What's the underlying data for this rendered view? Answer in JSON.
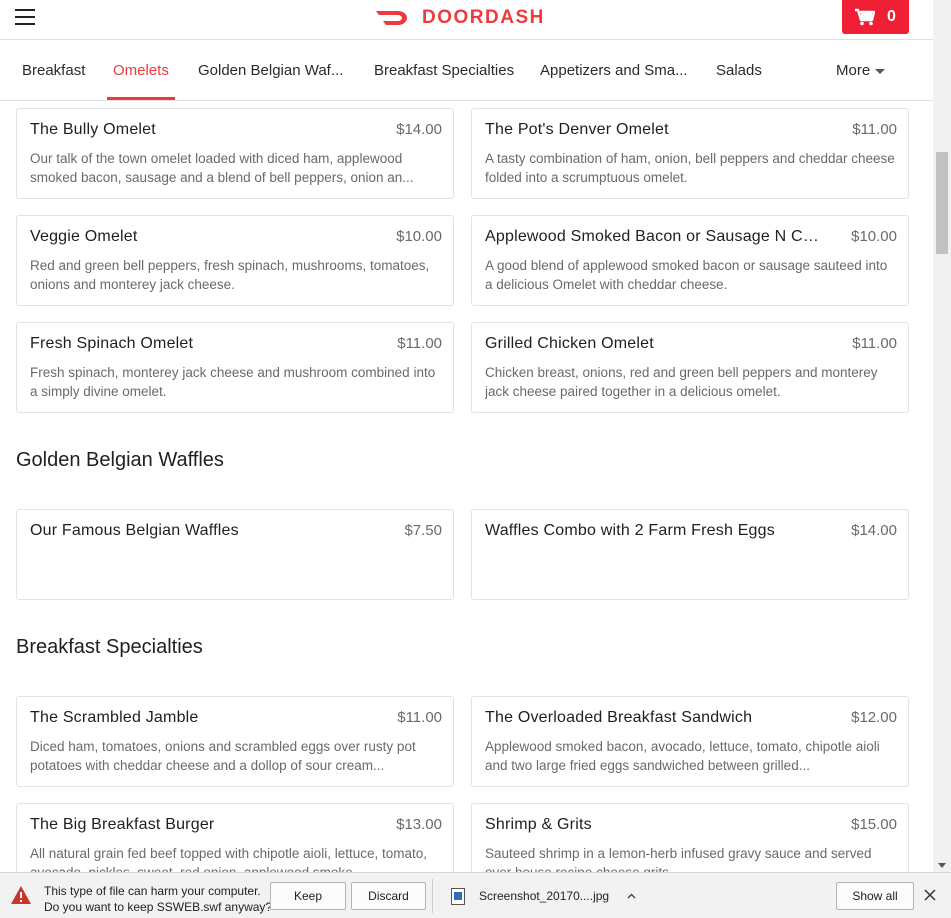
{
  "header": {
    "brand": "DOORDASH",
    "cart_count": "0",
    "brand_color": "#ef3a3d"
  },
  "tabs": [
    {
      "label": "Breakfast",
      "active": false
    },
    {
      "label": "Omelets",
      "active": true
    },
    {
      "label": "Golden Belgian Waf...",
      "active": false
    },
    {
      "label": "Breakfast Specialties",
      "active": false
    },
    {
      "label": "Appetizers and Sma...",
      "active": false
    },
    {
      "label": "Salads",
      "active": false
    },
    {
      "label": "More",
      "active": false
    }
  ],
  "omelets": [
    {
      "name": "The Bully Omelet",
      "price": "$14.00",
      "desc": "Our talk of the town omelet loaded with diced ham, applewood smoked bacon, sausage and a blend of bell peppers, onion an..."
    },
    {
      "name": "The Pot's Denver Omelet",
      "price": "$11.00",
      "desc": "A tasty combination of ham, onion, bell peppers and cheddar cheese folded into a scrumptuous omelet."
    },
    {
      "name": "Veggie Omelet",
      "price": "$10.00",
      "desc": "Red and green bell peppers, fresh spinach, mushrooms, tomatoes, onions and monterey jack cheese."
    },
    {
      "name": "Applewood Smoked Bacon or Sausage N Chee...",
      "price": "$10.00",
      "desc": "A good blend of applewood smoked bacon or sausage sauteed into a delicious Omelet with cheddar cheese."
    },
    {
      "name": "Fresh Spinach Omelet",
      "price": "$11.00",
      "desc": "Fresh spinach, monterey jack cheese and mushroom combined into a simply divine omelet."
    },
    {
      "name": "Grilled Chicken Omelet",
      "price": "$11.00",
      "desc": "Chicken breast, onions, red and green bell peppers and monterey jack cheese paired together in a delicious omelet."
    }
  ],
  "waffles": {
    "title": "Golden Belgian Waffles",
    "items": [
      {
        "name": "Our Famous Belgian Waffles",
        "price": "$7.50",
        "desc": ""
      },
      {
        "name": "Waffles Combo with 2 Farm Fresh Eggs",
        "price": "$14.00",
        "desc": ""
      }
    ]
  },
  "specialties": {
    "title": "Breakfast Specialties",
    "items": [
      {
        "name": "The Scrambled Jamble",
        "price": "$11.00",
        "desc": "Diced ham, tomatoes, onions and scrambled eggs over rusty pot potatoes with cheddar cheese and a dollop of sour cream..."
      },
      {
        "name": "The Overloaded Breakfast Sandwich",
        "price": "$12.00",
        "desc": "Applewood smoked bacon, avocado, lettuce, tomato, chipotle aioli and two large fried eggs sandwiched between grilled..."
      },
      {
        "name": "The Big Breakfast Burger",
        "price": "$13.00",
        "desc": "All natural grain fed beef topped with chipotle aioli, lettuce, tomato, avocado, pickles, sweet, red onion, applewood smoke..."
      },
      {
        "name": "Shrimp & Grits",
        "price": "$15.00",
        "desc": "Sauteed shrimp in a lemon-herb infused gravy sauce and served over house recipe cheese grits."
      }
    ]
  },
  "download_bar": {
    "message_line1": "This type of file can harm your computer.",
    "message_line2": "Do you want to keep SSWEB.swf anyway?",
    "keep_label": "Keep",
    "discard_label": "Discard",
    "file_name": "Screenshot_20170....jpg",
    "show_all_label": "Show all"
  }
}
